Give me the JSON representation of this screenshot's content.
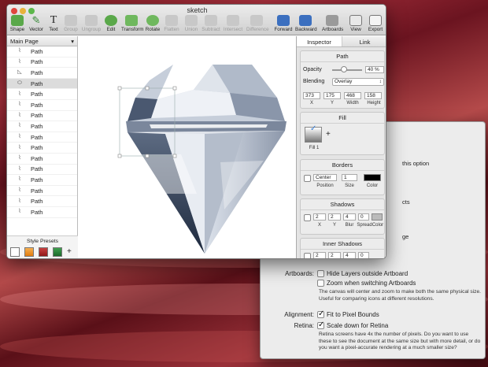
{
  "window": {
    "title": "sketch"
  },
  "toolbar": {
    "shape": "Shape",
    "vector": "Vector",
    "text": "Text",
    "group": "Group",
    "ungroup": "Ungroup",
    "edit": "Edit",
    "transform": "Transform",
    "rotate": "Rotate",
    "flatten": "Flatten",
    "union": "Union",
    "subtract": "Subtract",
    "intersect": "Intersect",
    "difference": "Difference",
    "forward": "Forward",
    "backward": "Backward",
    "artboards": "Artboards",
    "view": "View",
    "export": "Export"
  },
  "layers": {
    "page": "Main Page",
    "items": [
      "Path",
      "Path",
      "Path",
      "Path",
      "Path",
      "Path",
      "Path",
      "Path",
      "Path",
      "Path",
      "Path",
      "Path",
      "Path",
      "Path",
      "Path",
      "Path"
    ],
    "presets_title": "Style Presets",
    "add": "+"
  },
  "inspector": {
    "tab_inspector": "Inspector",
    "tab_link": "Link",
    "path": "Path",
    "opacity_label": "Opacity",
    "opacity_value": "40 %",
    "opacity_fraction": 0.4,
    "blending_label": "Blending",
    "blending_value": "Overlay",
    "x": "373",
    "y": "175",
    "width": "468",
    "height": "158",
    "x_label": "X",
    "y_label": "Y",
    "width_label": "Width",
    "height_label": "Height",
    "fill": "Fill",
    "fill_item": "Fill 1",
    "fill_add": "+",
    "borders": "Borders",
    "border_position": "Center",
    "border_size": "1",
    "position_label": "Position",
    "size_label": "Size",
    "color_label": "Color",
    "shadows": "Shadows",
    "sh_x": "2",
    "sh_y": "2",
    "sh_blur": "4",
    "sh_spread": "0",
    "blur_label": "Blur",
    "spread_label": "Spread",
    "inner_shadows": "Inner Shadows",
    "is_x": "2",
    "is_y": "2",
    "is_blur": "4",
    "is_spread": "0"
  },
  "prefs": {
    "partial1": "this option",
    "partial2": "cts",
    "partial3": "ge",
    "artboards_label": "Artboards:",
    "hide_layers": "Hide Layers outside Artboard",
    "zoom_switch": "Zoom when switching Artboards",
    "artboards_desc": "The canvas will center and zoom to make both the same physical size. Useful for comparing icons at different resolutions.",
    "alignment_label": "Alignment:",
    "fit_pixel": "Fit to Pixel Bounds",
    "retina_label": "Retina:",
    "scale_down": "Scale down for Retina",
    "retina_desc": "Retina screens have 4x the number of pixels. Do you want to use these to see the document at the same size but with more detail, or do you want a pixel-accurate rendering at a much smaller size?"
  },
  "colors": {
    "accent": "#3b7fd6",
    "border_color": "#000000",
    "preset1": "#ffffff",
    "preset2": "#f0961e",
    "preset3": "#b02828",
    "preset4": "#2a8a3a"
  }
}
